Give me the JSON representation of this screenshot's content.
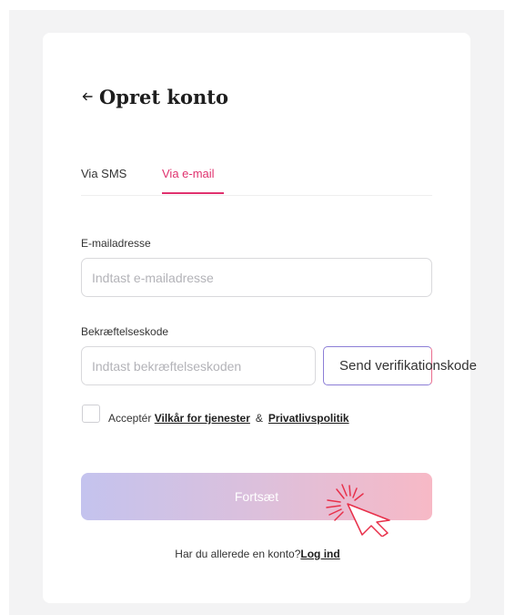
{
  "header": {
    "back_icon": "arrow-left-icon",
    "title": "Opret konto"
  },
  "tabs": [
    {
      "label": "Via SMS",
      "active": false
    },
    {
      "label": "Via e-mail",
      "active": true
    }
  ],
  "form": {
    "email": {
      "label": "E-mailadresse",
      "placeholder": "Indtast e-mailadresse",
      "value": ""
    },
    "code": {
      "label": "Bekræftelseskode",
      "placeholder": "Indtast bekræftelseskoden",
      "value": ""
    },
    "send_code_label": "Send verifikationskode",
    "consent": {
      "checked": false,
      "prefix": "Acceptér",
      "terms_link": "Vilkår for tjenester",
      "separator": "&",
      "privacy_link": "Privatlivspolitik"
    },
    "continue_label": "Fortsæt"
  },
  "footer": {
    "question": "Har du allerede en konto?",
    "login_link": "Log ind"
  },
  "colors": {
    "accent": "#e0316e",
    "gradient_start": "#c4c3ee",
    "gradient_end": "#f7b9c6",
    "cursor_red": "#e8304a"
  },
  "overlay_icon": "click-cursor-icon"
}
